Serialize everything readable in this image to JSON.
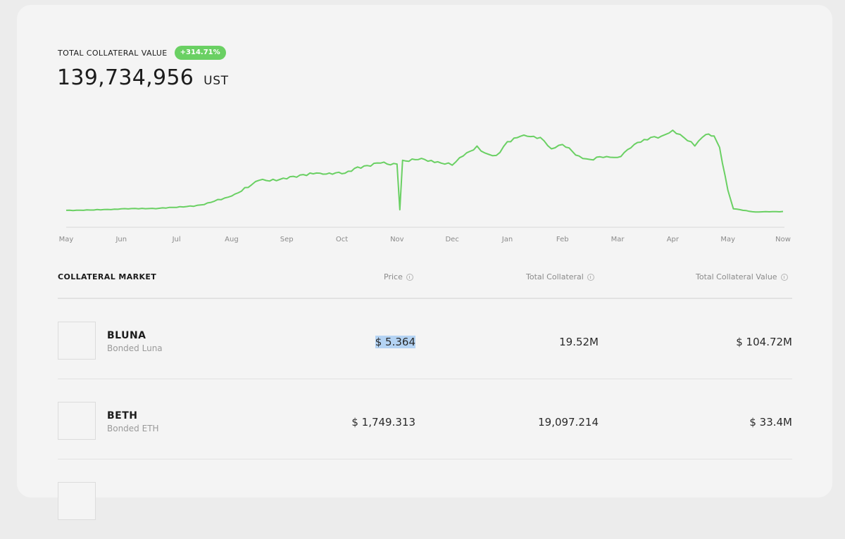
{
  "summary": {
    "label": "TOTAL COLLATERAL VALUE",
    "change": "+314.71%",
    "value": "139,734,956",
    "unit": "UST",
    "accent_color": "#6ad063"
  },
  "chart_data": {
    "type": "line",
    "title": "",
    "xlabel": "",
    "ylabel": "",
    "x_tick_labels": [
      "May",
      "Jun",
      "Jul",
      "Aug",
      "Sep",
      "Oct",
      "Nov",
      "Dec",
      "Jan",
      "Feb",
      "Mar",
      "Apr",
      "May",
      "Now"
    ],
    "y_axis_shown": false,
    "grid": false,
    "line_color": "#6ad063",
    "series": [
      {
        "values": [
          [
            0,
            2.0
          ],
          [
            0.5,
            2.1
          ],
          [
            1,
            2.5
          ],
          [
            1.5,
            2.6
          ],
          [
            2,
            3.0
          ],
          [
            2.5,
            4.0
          ],
          [
            3,
            7.0
          ],
          [
            3.3,
            10.0
          ],
          [
            3.5,
            12.5
          ],
          [
            4,
            13.0
          ],
          [
            4.3,
            14.5
          ],
          [
            4.6,
            15.0
          ],
          [
            5,
            14.8
          ],
          [
            5.4,
            17.5
          ],
          [
            5.7,
            18.5
          ],
          [
            6,
            18.2
          ],
          [
            6.05,
            2.2
          ],
          [
            6.1,
            19.5
          ],
          [
            6.5,
            19.8
          ],
          [
            6.8,
            18.5
          ],
          [
            7,
            17.8
          ],
          [
            7.2,
            21.0
          ],
          [
            7.45,
            24.5
          ],
          [
            7.6,
            22.0
          ],
          [
            7.8,
            21.2
          ],
          [
            8,
            26.0
          ],
          [
            8.3,
            28.3
          ],
          [
            8.6,
            27.5
          ],
          [
            8.8,
            23.5
          ],
          [
            9,
            25.0
          ],
          [
            9.3,
            21.0
          ],
          [
            9.5,
            19.8
          ],
          [
            9.8,
            20.8
          ],
          [
            10,
            20.5
          ],
          [
            10.3,
            25.0
          ],
          [
            10.6,
            27.5
          ],
          [
            10.8,
            28.0
          ],
          [
            11,
            30.0
          ],
          [
            11.2,
            27.5
          ],
          [
            11.4,
            24.5
          ],
          [
            11.6,
            28.5
          ],
          [
            11.75,
            28.0
          ],
          [
            11.85,
            24.0
          ],
          [
            12,
            9.0
          ],
          [
            12.1,
            2.5
          ],
          [
            12.5,
            1.4
          ],
          [
            13,
            1.6
          ]
        ]
      }
    ],
    "y_range": [
      0,
      32
    ]
  },
  "table": {
    "title": "COLLATERAL MARKET",
    "columns": [
      "Price",
      "Total Collateral",
      "Total Collateral Value"
    ],
    "rows": [
      {
        "symbol": "BLUNA",
        "name": "Bonded Luna",
        "price": "$ 5.364",
        "total_collateral": "19.52M",
        "total_collateral_value": "$ 104.72M"
      },
      {
        "symbol": "BETH",
        "name": "Bonded ETH",
        "price": "$ 1,749.313",
        "total_collateral": "19,097.214",
        "total_collateral_value": "$ 33.4M"
      }
    ]
  }
}
